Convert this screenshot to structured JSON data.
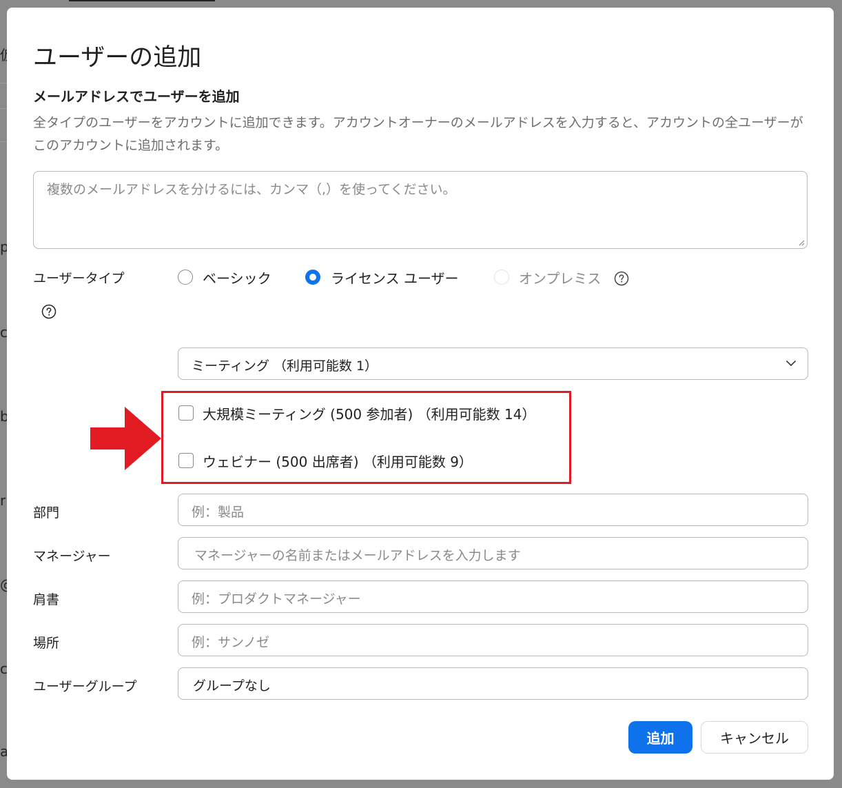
{
  "background": {
    "peek_chars": [
      "仮",
      "p",
      "c",
      "b",
      "r",
      "@",
      "cs",
      "a"
    ]
  },
  "dialog": {
    "title": "ユーザーの追加",
    "section_title": "メールアドレスでユーザーを追加",
    "description": "全タイプのユーザーをアカウントに追加できます。アカウントオーナーのメールアドレスを入力すると、アカウントの全ユーザーがこのアカウントに追加されます。",
    "email_placeholder": "複数のメールアドレスを分けるには、カンマ（,）を使ってください。"
  },
  "user_type": {
    "label": "ユーザータイプ",
    "options": [
      {
        "label": "ベーシック",
        "selected": false,
        "disabled": false
      },
      {
        "label": "ライセンス ユーザー",
        "selected": true,
        "disabled": false
      },
      {
        "label": "オンプレミス",
        "selected": false,
        "disabled": true
      }
    ],
    "license_select": "ミーティング （利用可能数 1）"
  },
  "addons": [
    {
      "label": "大規模ミーティング (500 参加者) （利用可能数 14）",
      "checked": false
    },
    {
      "label": "ウェビナー (500 出席者) （利用可能数 9）",
      "checked": false
    }
  ],
  "fields": {
    "department": {
      "label": "部門",
      "placeholder": "例：製品"
    },
    "manager": {
      "label": "マネージャー",
      "placeholder": "マネージャーの名前またはメールアドレスを入力します"
    },
    "job_title": {
      "label": "肩書",
      "placeholder": "例：プロダクトマネージャー"
    },
    "location": {
      "label": "場所",
      "placeholder": "例：サンノゼ"
    },
    "user_group": {
      "label": "ユーザーグループ",
      "value": "グループなし"
    }
  },
  "buttons": {
    "add": "追加",
    "cancel": "キャンセル"
  },
  "colors": {
    "accent": "#0e72ed",
    "highlight": "#e21b23"
  }
}
